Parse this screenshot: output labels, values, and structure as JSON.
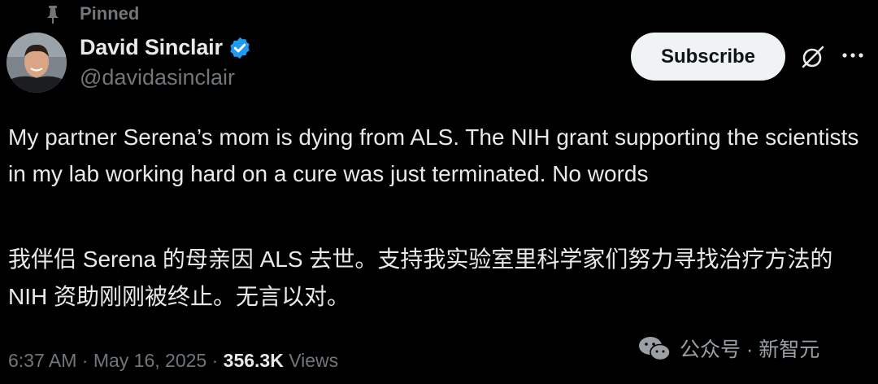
{
  "pinned": {
    "label": "Pinned"
  },
  "author": {
    "display_name": "David Sinclair",
    "handle": "@davidasinclair",
    "verified_color": "#1d9bf0"
  },
  "actions": {
    "subscribe_label": "Subscribe",
    "grok_icon": "grok-icon",
    "more_icon": "more-icon"
  },
  "tweet": {
    "text_en": "My partner Serena’s mom is dying from ALS. The NIH grant supporting the scientists in my lab working hard on a cure was just terminated. No words",
    "text_zh": "我伴侣 Serena 的母亲因 ALS 去世。支持我实验室里科学家们努力寻找治疗方法的 NIH 资助刚刚被终止。无言以对。"
  },
  "meta": {
    "time": "6:37 AM",
    "date": "May 16, 2025",
    "sep": "·",
    "views_count": "356.3K",
    "views_label": "Views"
  },
  "watermark": {
    "text": "公众号 · 新智元"
  },
  "colors": {
    "background": "#000000",
    "primary_text": "#e7e9ea",
    "secondary_text": "#71767b",
    "button_bg": "#eff3f4"
  }
}
